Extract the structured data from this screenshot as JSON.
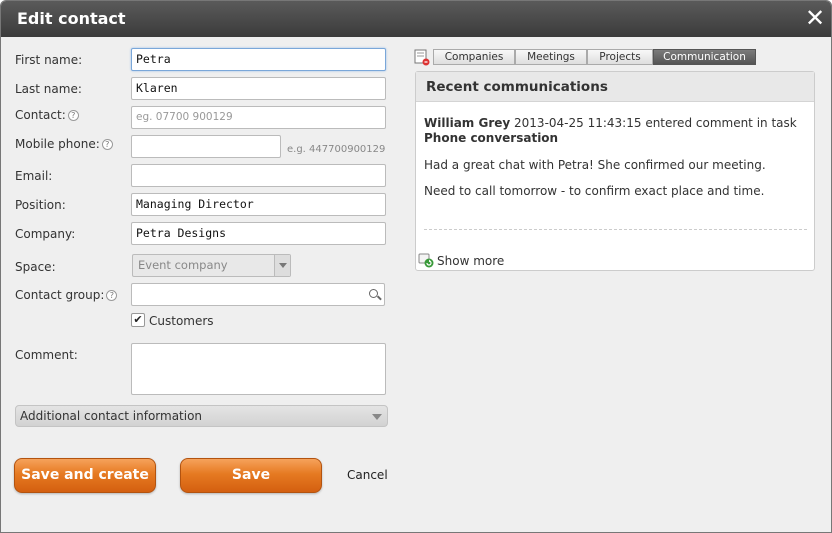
{
  "dialog": {
    "title": "Edit contact",
    "close_glyph": "✕"
  },
  "form": {
    "first_name": {
      "label": "First name:",
      "value": "Petra"
    },
    "last_name": {
      "label": "Last name:",
      "value": "Klaren"
    },
    "contact": {
      "label": "Contact:",
      "placeholder": "eg. 07700 900129"
    },
    "mobile_phone": {
      "label": "Mobile phone:",
      "hint": "e.g. 447700900129"
    },
    "email": {
      "label": "Email:",
      "value": ""
    },
    "position": {
      "label": "Position:",
      "value": "Managing Director"
    },
    "company": {
      "label": "Company:",
      "value": "Petra Designs"
    },
    "space": {
      "label": "Space:",
      "selected": "Event company"
    },
    "contact_group": {
      "label": "Contact group:"
    },
    "customers": {
      "label": "Customers",
      "checked_glyph": "✔"
    },
    "comment": {
      "label": "Comment:"
    },
    "additional": {
      "label": "Additional contact information"
    }
  },
  "help_glyph": "?",
  "buttons": {
    "save_and_create": "Save and create",
    "save": "Save",
    "cancel": "Cancel"
  },
  "tabs": [
    {
      "label": "Companies"
    },
    {
      "label": "Meetings"
    },
    {
      "label": "Projects"
    },
    {
      "label": "Communication",
      "active": true
    }
  ],
  "recent": {
    "title": "Recent communications",
    "author": "William Grey",
    "timestamp": "2013-04-25 11:43:15",
    "action": "entered comment in task",
    "task": "Phone conversation",
    "message1": "Had a great chat with Petra! She confirmed our meeting.",
    "message2": "Need to call tomorrow - to confirm exact place and time.",
    "show_more": "Show more"
  },
  "icons": {
    "close": "close-icon",
    "help": "help-icon",
    "search": "search-icon",
    "dropdown": "chevron-down-icon",
    "show_more": "refresh-icon"
  },
  "colors": {
    "accent_orange": "#e67a22",
    "titlebar": "#4a4a4a",
    "active_tab": "#666666"
  }
}
